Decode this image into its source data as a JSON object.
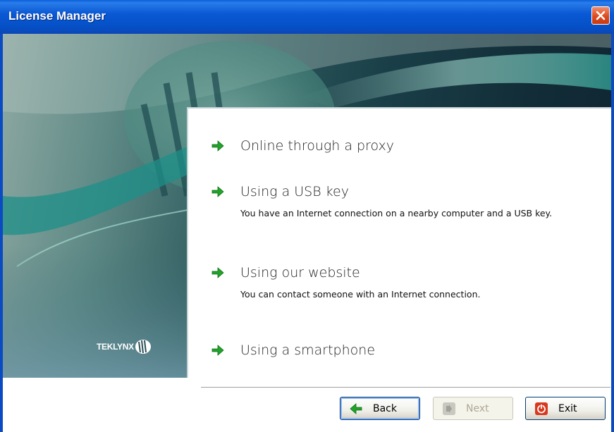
{
  "window": {
    "title": "License Manager"
  },
  "branding": {
    "logo_text": "TEKLYNX"
  },
  "options": [
    {
      "title": "Online through a proxy",
      "description": ""
    },
    {
      "title": "Using a USB key",
      "description": "You have an Internet connection on a nearby computer and a USB key."
    },
    {
      "title": "Using our website",
      "description": "You can contact someone with an Internet connection."
    },
    {
      "title": "Using a smartphone",
      "description": ""
    }
  ],
  "buttons": {
    "back_label": "Back",
    "next_label": "Next",
    "exit_label": "Exit"
  },
  "colors": {
    "title_bar": "#0a58d4",
    "arrow_green": "#22a32a",
    "exit_red": "#d8381e"
  },
  "icons": {
    "close": "close-icon",
    "option_arrow": "arrow-right-icon",
    "back": "arrow-left-icon",
    "next": "next-icon",
    "exit": "power-icon"
  }
}
